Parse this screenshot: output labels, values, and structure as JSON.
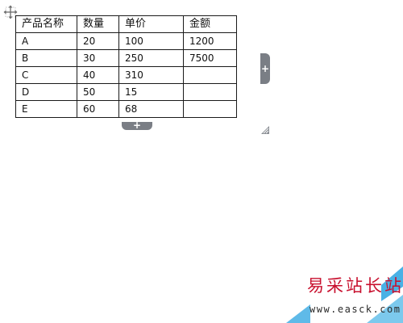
{
  "table": {
    "headers": [
      "产品名称",
      "数量",
      "单价",
      "金额"
    ],
    "rows": [
      [
        "A",
        "20",
        "100",
        "1200"
      ],
      [
        "B",
        "30",
        "250",
        "7500"
      ],
      [
        "C",
        "40",
        "310",
        ""
      ],
      [
        "D",
        "50",
        "15",
        ""
      ],
      [
        "E",
        "60",
        "68",
        ""
      ]
    ]
  },
  "controls": {
    "add_column_label": "+",
    "add_row_label": "+"
  },
  "icons": {
    "move": "move-icon",
    "resize": "resize-icon"
  },
  "colors": {
    "handle_gray": "#7a7e85",
    "watermark_red": "#c8102e",
    "watermark_blue": "#29a3e0"
  },
  "watermark": {
    "title": "易采站长站",
    "url": "www.easck.com"
  }
}
